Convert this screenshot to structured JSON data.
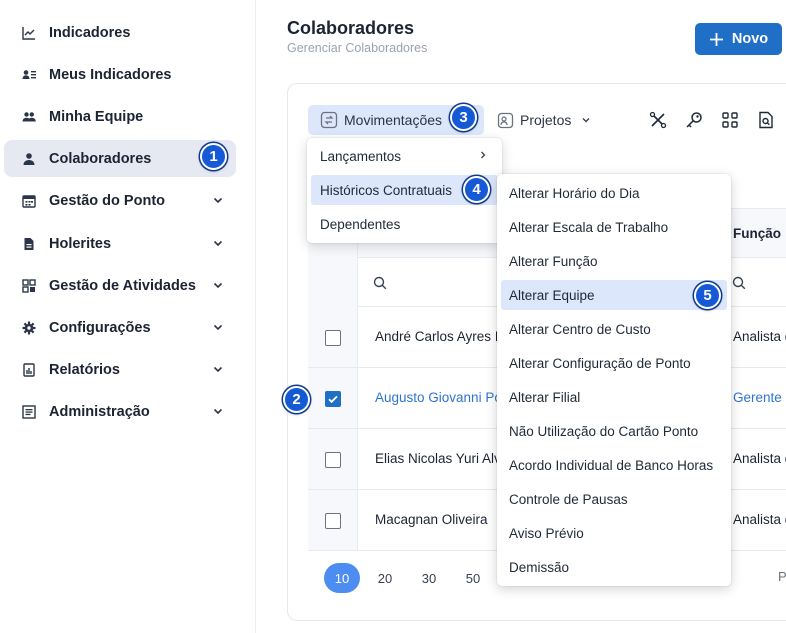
{
  "sidebar": {
    "items": [
      {
        "label": "Indicadores",
        "icon": "chart-line-icon"
      },
      {
        "label": "Meus Indicadores",
        "icon": "user-list-icon"
      },
      {
        "label": "Minha Equipe",
        "icon": "users-icon"
      },
      {
        "label": "Colaboradores",
        "icon": "user-icon",
        "active": true
      },
      {
        "label": "Gestão do Ponto",
        "icon": "calendar-icon",
        "expandable": true
      },
      {
        "label": "Holerites",
        "icon": "document-icon",
        "expandable": true
      },
      {
        "label": "Gestão de Atividades",
        "icon": "grid-icon",
        "expandable": true
      },
      {
        "label": "Configurações",
        "icon": "gear-icon",
        "expandable": true
      },
      {
        "label": "Relatórios",
        "icon": "report-icon",
        "expandable": true
      },
      {
        "label": "Administração",
        "icon": "admin-icon",
        "expandable": true
      }
    ]
  },
  "header": {
    "title": "Colaboradores",
    "subtitle": "Gerenciar Colaboradores",
    "new_button": "Novo"
  },
  "toolbar": {
    "movimentacoes": "Movimentações",
    "projetos": "Projetos"
  },
  "table": {
    "funcao_header": "Função",
    "rows": [
      {
        "name": "André Carlos Ayres I",
        "funcao": "Analista d",
        "checked": false
      },
      {
        "name": "Augusto Giovanni Po",
        "funcao": "Gerente",
        "checked": true
      },
      {
        "name": "Elias Nicolas Yuri Alv",
        "funcao": "Analista d",
        "checked": false
      },
      {
        "name": "Macagnan Oliveira",
        "funcao": "Analista d",
        "checked": false
      }
    ],
    "page_sizes": [
      "10",
      "20",
      "30",
      "50"
    ],
    "active_page_size": "10",
    "pagination_partial": "P"
  },
  "menu_movimentacoes": {
    "items": [
      "Lançamentos",
      "Históricos Contratuais",
      "Dependentes"
    ]
  },
  "menu_historicos": {
    "items": [
      "Alterar Horário do Dia",
      "Alterar Escala de Trabalho",
      "Alterar Função",
      "Alterar Equipe",
      "Alterar Centro de Custo",
      "Alterar Configuração de Ponto",
      "Alterar Filial",
      "Não Utilização do Cartão Ponto",
      "Acordo Individual de Banco Horas",
      "Controle de Pausas",
      "Aviso Prévio",
      "Demissão"
    ]
  },
  "badges": [
    "1",
    "2",
    "3",
    "4",
    "5"
  ],
  "colors": {
    "primary": "#1f6fc7",
    "highlight": "#dde7fb",
    "badge": "#1659d6",
    "selected_text": "#2f73d1"
  }
}
